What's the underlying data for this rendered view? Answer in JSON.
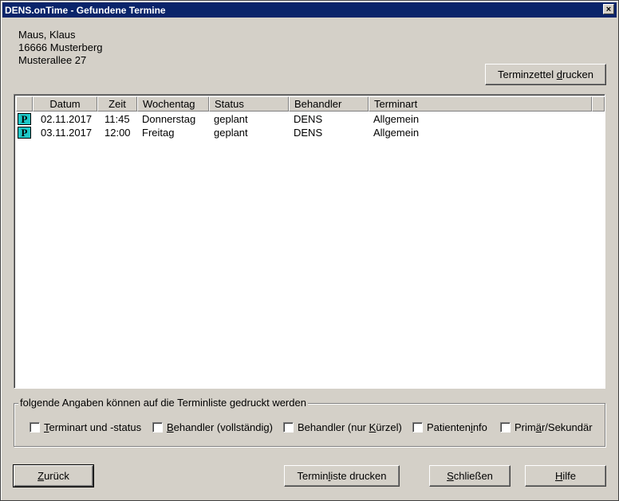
{
  "window": {
    "title": "DENS.onTime - Gefundene Termine",
    "close_label": "×"
  },
  "patient": {
    "name": "Maus, Klaus",
    "city": "16666 Musterberg",
    "street": "Musterallee 27"
  },
  "buttons": {
    "terminzettel_pre": "Terminzettel ",
    "terminzettel_ul": "d",
    "terminzettel_post": "rucken",
    "zurueck_ul": "Z",
    "zurueck_post": "urück",
    "terminliste_pre": "Termin",
    "terminliste_ul": "l",
    "terminliste_post": "iste drucken",
    "schliessen_pre": "",
    "schliessen_ul": "S",
    "schliessen_post": "chließen",
    "hilfe_ul": "H",
    "hilfe_post": "ilfe"
  },
  "table": {
    "columns": [
      "",
      "Datum",
      "Zeit",
      "Wochentag",
      "Status",
      "Behandler",
      "Terminart"
    ],
    "rows": [
      {
        "icon": "P",
        "datum": "02.11.2017",
        "zeit": "11:45",
        "wochentag": "Donnerstag",
        "status": "geplant",
        "behandler": "DENS",
        "terminart": "Allgemein"
      },
      {
        "icon": "P",
        "datum": "03.11.2017",
        "zeit": "12:00",
        "wochentag": "Freitag",
        "status": "geplant",
        "behandler": "DENS",
        "terminart": "Allgemein"
      }
    ]
  },
  "print_options": {
    "label": "folgende Angaben können auf die Terminliste gedruckt werden",
    "options": [
      {
        "pre": "",
        "ul": "T",
        "post": "erminart und -status",
        "checked": false
      },
      {
        "pre": "",
        "ul": "B",
        "post": "ehandler (vollständig)",
        "checked": false
      },
      {
        "pre": "Behandler (nur ",
        "ul": "K",
        "post": "ürzel)",
        "checked": false
      },
      {
        "pre": "Patienten",
        "ul": "i",
        "post": "nfo",
        "checked": false
      },
      {
        "pre": "Prim",
        "ul": "ä",
        "post": "r/Sekundär",
        "checked": false
      }
    ]
  },
  "colors": {
    "titlebar": "#0a246a",
    "face": "#d4d0c8",
    "status_icon": "#1ec8c8"
  }
}
